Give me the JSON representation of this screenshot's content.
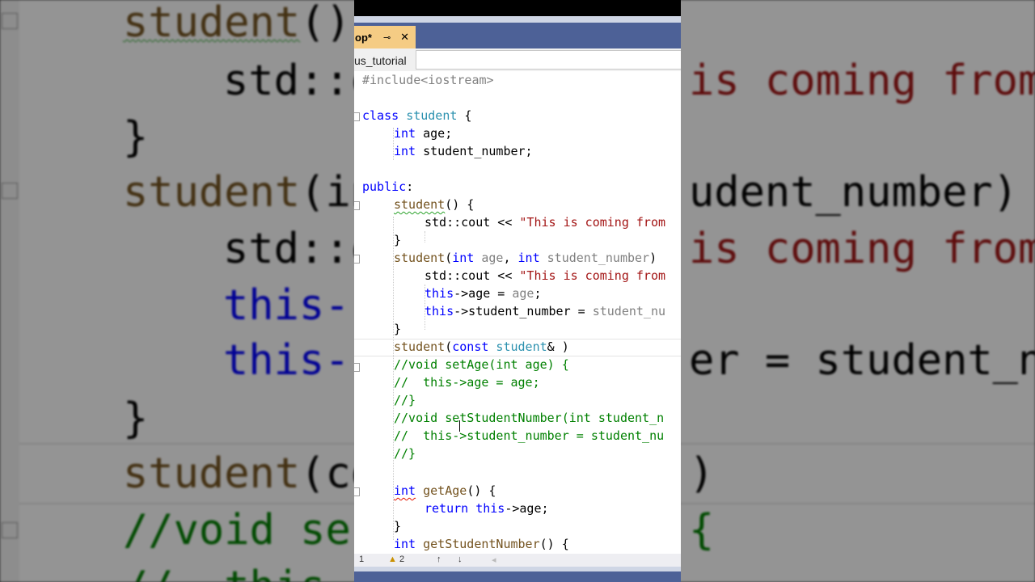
{
  "editor": {
    "tab_name": "op*",
    "tab_pin": "⊸",
    "tab_close": "✕",
    "project_name": "us_tutorial",
    "status": {
      "line": "1",
      "warning_icon": "warning-triangle-icon",
      "warning_count": "2",
      "up_arrow": "↑",
      "down_arrow": "↓",
      "left_arrow": "◂"
    },
    "colors": {
      "keyword": "#0000ff",
      "type": "#2b91af",
      "function": "#74531f",
      "string": "#a31515",
      "comment": "#008000",
      "tab_active": "#f5cc84",
      "tab_row": "#4d6197"
    },
    "code": {
      "l1": "#include<iostream>",
      "l3_kw": "class",
      "l3_name": "student",
      "l3_rest": " {",
      "l4_kw": "int",
      "l4_rest": " age;",
      "l5_kw": "int",
      "l5_rest": " student_number;",
      "l7_kw": "public",
      "l7_rest": ":",
      "l8_fn": "student",
      "l8_rest": "() {",
      "l9_a": "std::cout << ",
      "l9_str": "\"This is coming from",
      "l10": "}",
      "l11_fn": "student",
      "l11_p1": "(",
      "l11_kw1": "int",
      "l11_pa1": " age",
      "l11_p2": ", ",
      "l11_kw2": "int",
      "l11_pa2": " student_number",
      "l11_p3": ")",
      "l12_a": "std::cout << ",
      "l12_str": "\"This is coming from",
      "l13_kw": "this",
      "l13_a": "->age = ",
      "l13_pa": "age",
      "l13_b": ";",
      "l14_kw": "this",
      "l14_a": "->student_number = ",
      "l14_pa": "student_nu",
      "l15": "}",
      "l16_fn": "student",
      "l16_a": "(",
      "l16_kw": "const",
      "l16_ty": " student",
      "l16_b": "& )",
      "l17": "//void setAge(int age) {",
      "l18": "//  this->age = age;",
      "l19": "//}",
      "l20": "//void setStudentNumber(int student_n",
      "l21": "//  this->student_number = student_nu",
      "l22": "//}",
      "l24_kw": "int",
      "l24_fn": " getAge",
      "l24_rest": "() {",
      "l25_kw1": "return",
      "l25_kw2": " this",
      "l25_rest": "->age;",
      "l26": "}",
      "l27_kw": "int",
      "l27_fn": " getStudentNumber",
      "l27_rest": "() {"
    }
  },
  "backdrop": {
    "b1_fn": "student",
    "b1_rest": "()",
    "b1_right": "is coming from",
    "b2": "std::c",
    "b3": "}",
    "b4_fn": "student",
    "b4_rest": "(in",
    "b4_right": "udent_number)",
    "b5": "std::c",
    "b5_right": "is coming from",
    "b6_kw": "this-",
    "b7_kw": "this-",
    "b7_right": "er = student_nu",
    "b8": "}",
    "b9_fn": "student",
    "b9_rest": "(co",
    "b9_right": ")",
    "b10": "//void se",
    "b10_right": "{",
    "b11": "//  this-"
  }
}
